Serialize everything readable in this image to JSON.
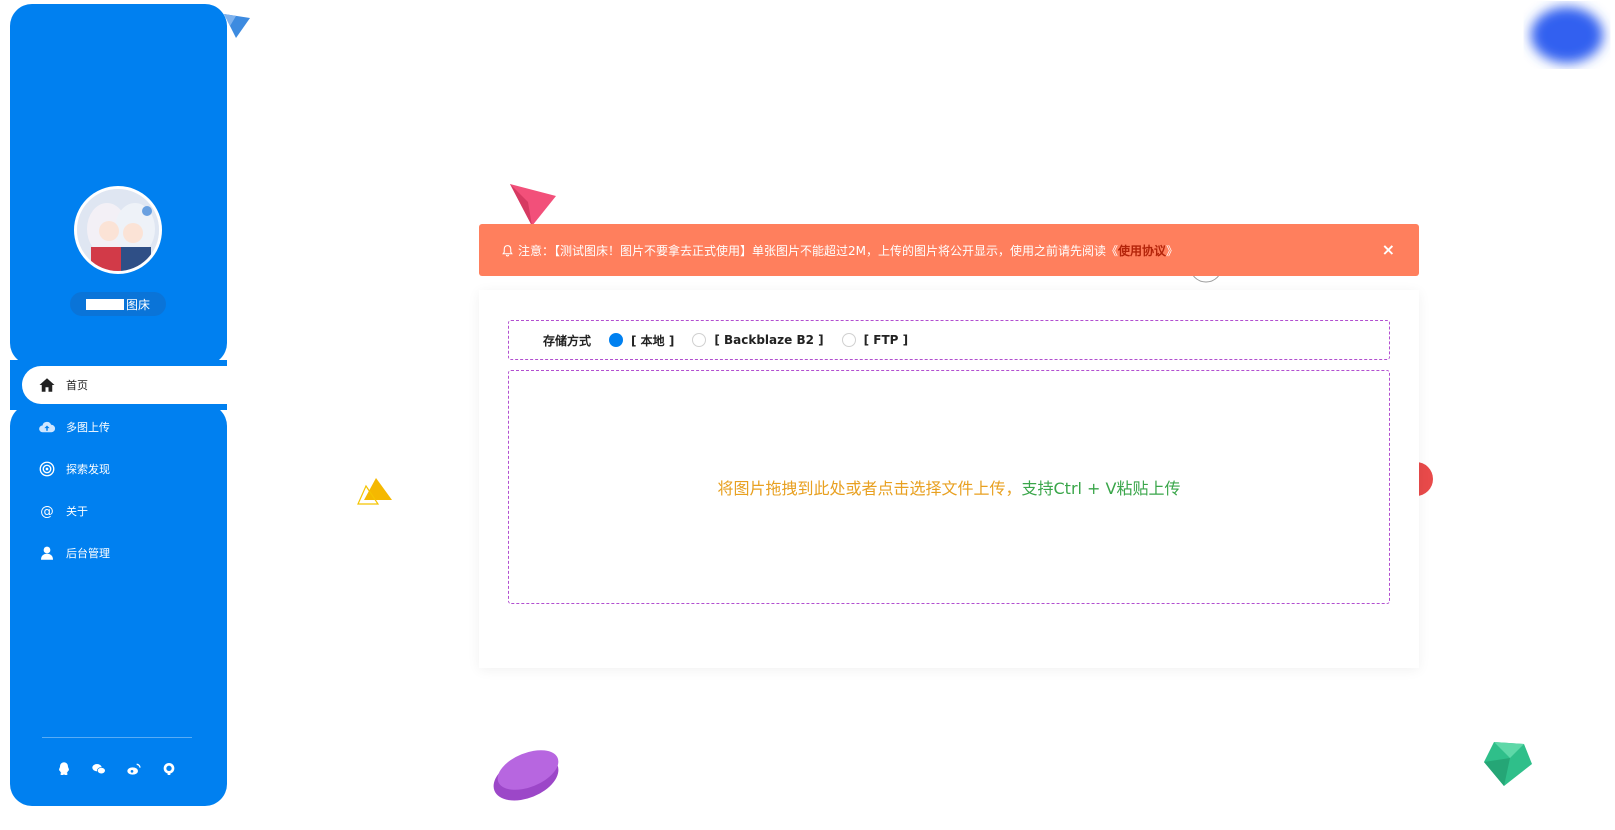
{
  "sidebar": {
    "site_name": "图床",
    "nav": [
      {
        "label": "首页",
        "icon": "home-icon",
        "active": true
      },
      {
        "label": "多图上传",
        "icon": "cloud-upload-icon"
      },
      {
        "label": "探索发现",
        "icon": "target-icon"
      },
      {
        "label": "关于",
        "icon": "at-icon"
      },
      {
        "label": "后台管理",
        "icon": "user-icon"
      }
    ],
    "social": [
      "qq-icon",
      "wechat-icon",
      "weibo-icon",
      "github-icon"
    ]
  },
  "alert": {
    "prefix": "注意：【测试图床！图片不要拿去正式使用】单张图片不能超过2M，上传的图片将公开显示，使用之前请先阅读《",
    "link": "使用协议",
    "suffix": "》",
    "close": "×"
  },
  "storage": {
    "label": "存储方式",
    "options": [
      {
        "label": "[ 本地 ]",
        "selected": true
      },
      {
        "label": "[ Backblaze B2 ]",
        "selected": false
      },
      {
        "label": "[ FTP ]",
        "selected": false
      }
    ]
  },
  "dropzone": {
    "segments": [
      {
        "text": "将图片拖拽到此处或者点击选择文件上传，",
        "color": "#e8a020"
      },
      {
        "text": "支持Ctrl + V粘贴上传",
        "color": "#3aa64a"
      }
    ]
  },
  "colors": {
    "sidebar": "#0080f0",
    "alert": "#ff7f5d",
    "accent_dashed": "#b24fd0"
  }
}
